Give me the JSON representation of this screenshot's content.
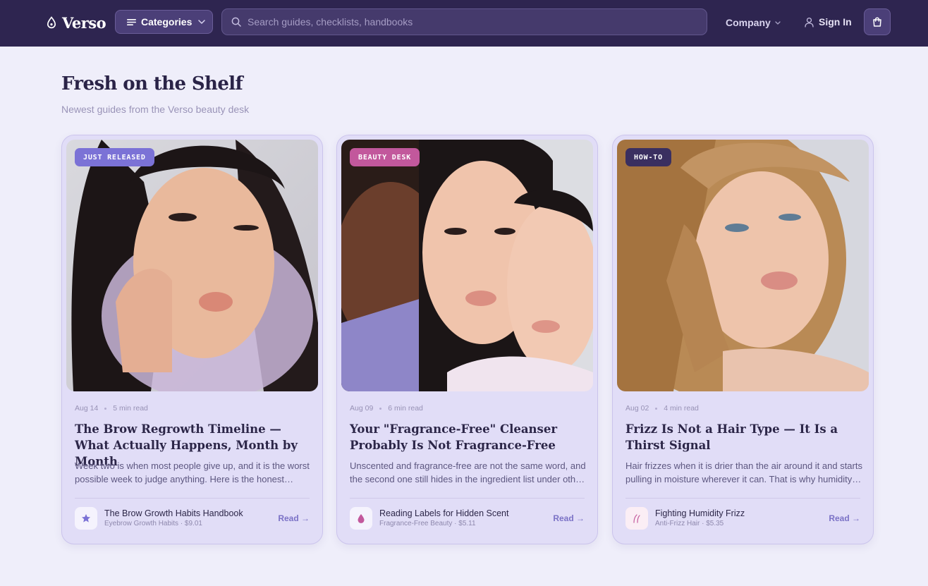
{
  "nav": {
    "brand": "Verso",
    "categories_label": "Categories",
    "search_placeholder": "Search guides, checklists, handbooks",
    "company_label": "Company",
    "signin_label": "Sign In"
  },
  "section": {
    "title": "Fresh on the Shelf",
    "subtitle": "Newest guides from the Verso beauty desk"
  },
  "cards": [
    {
      "badge": "JUST RELEASED",
      "badge_color": "#7b72d6",
      "date": "Aug 14",
      "read_time": "5 min read",
      "title": "The Brow Regrowth Timeline — What Actually Happens, Month by Month",
      "excerpt": "Week two is when most people give up, and it is the worst possible week to judge anything. Here is the honest month-by-month picture.",
      "product_name": "The Brow Growth Habits Handbook",
      "product_meta": "Eyebrow Growth Habits · $9.01",
      "product_icon": "star-icon",
      "read_label": "Read →"
    },
    {
      "badge": "BEAUTY DESK",
      "badge_color": "#c2589c",
      "date": "Aug 09",
      "read_time": "6 min read",
      "title": "Your \"Fragrance-Free\" Cleanser Probably Is Not Fragrance-Free",
      "excerpt": "Unscented and fragrance-free are not the same word, and the second one still hides in the ingredient list under other names.",
      "product_name": "Reading Labels for Hidden Scent",
      "product_meta": "Fragrance-Free Beauty · $5.11",
      "product_icon": "drop-icon",
      "read_label": "Read →"
    },
    {
      "badge": "HOW-TO",
      "badge_color": "#3a2f60",
      "date": "Aug 02",
      "read_time": "4 min read",
      "title": "Frizz Is Not a Hair Type — It Is a Thirst Signal",
      "excerpt": "Hair frizzes when it is drier than the air around it and starts pulling in moisture wherever it can. That is why humidity wins.",
      "product_name": "Fighting Humidity Frizz",
      "product_meta": "Anti-Frizz Hair · $5.35",
      "product_icon": "hair-strands-icon",
      "read_label": "Read →"
    }
  ]
}
